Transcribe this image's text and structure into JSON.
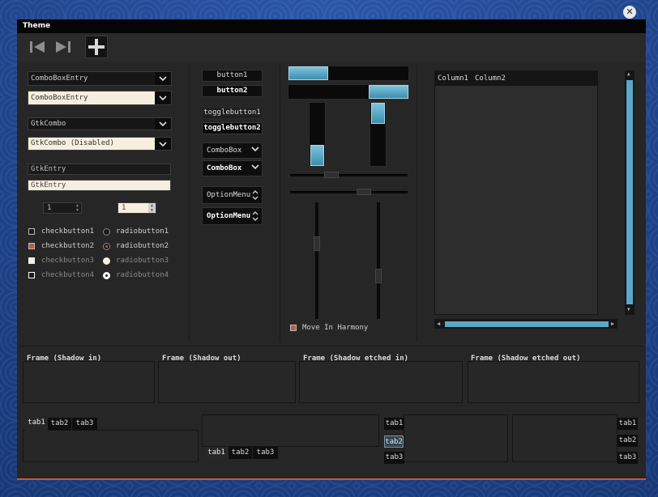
{
  "window": {
    "title": "Theme"
  },
  "toolbar": {
    "first_icon": "skip-first-icon",
    "last_icon": "skip-last-icon",
    "add_icon": "plus-icon"
  },
  "left": {
    "combo_entry_1": "ComboBoxEntry",
    "combo_entry_2": "ComboBoxEntry",
    "gtk_combo": "GtkCombo",
    "gtk_combo_disabled": "GtkCombo (Disabled)",
    "entry_1": "GtkEntry",
    "entry_2": "GtkEntry",
    "spin_1": "1",
    "spin_2": "1",
    "checks": [
      "checkbutton1",
      "checkbutton2",
      "checkbutton3",
      "checkbutton4"
    ],
    "radios": [
      "radiobutton1",
      "radiobutton2",
      "radiobutton3",
      "radiobutton4"
    ]
  },
  "middle": {
    "button1": "button1",
    "button2": "button2",
    "toggle1": "togglebutton1",
    "toggle2": "togglebutton2",
    "combobox1": "ComboBox",
    "combobox2": "ComboBox",
    "option1": "OptionMenu",
    "option2": "OptionMenu"
  },
  "sliders": {
    "hprogress_1": 0.33,
    "hprogress_2": 0.33,
    "vprogress_1": 0.33,
    "vprogress_2": 0.33,
    "move_in_harmony": "Move In Harmony"
  },
  "tree": {
    "columns": [
      "Column1",
      "Column2"
    ]
  },
  "frames": [
    "Frame (Shadow in)",
    "Frame (Shadow out)",
    "Frame (Shadow etched in)",
    "Frame (Shadow etched out)"
  ],
  "tabs": {
    "top": [
      "tab1",
      "tab2",
      "tab3"
    ],
    "bottom": [
      "tab1",
      "tab2",
      "tab3"
    ],
    "left": [
      "tab1",
      "tab2",
      "tab3"
    ],
    "right": [
      "tab1",
      "tab2",
      "tab3"
    ]
  },
  "colors": {
    "accent": "#c9573a",
    "progress": "#5aa8c8",
    "background": "#262626"
  }
}
